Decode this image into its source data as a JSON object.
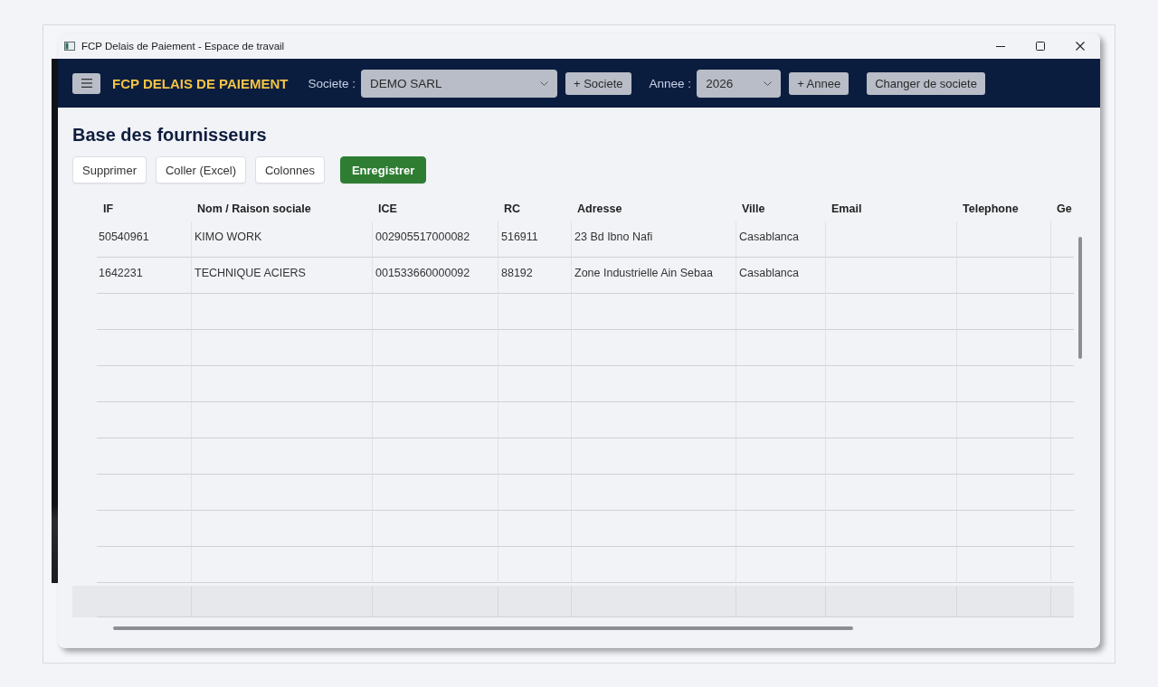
{
  "window": {
    "title": "FCP Delais de Paiement - Espace de travail"
  },
  "header": {
    "app_title": "FCP DELAIS DE PAIEMENT",
    "company": {
      "label": "Societe :",
      "value": "DEMO SARL"
    },
    "add_company_button": "+ Societe",
    "year": {
      "label": "Annee :",
      "value": "2026"
    },
    "add_year_button": "+ Annee",
    "change_company_button": "Changer de societe"
  },
  "page": {
    "title": "Base des fournisseurs"
  },
  "toolbar": [
    {
      "label": "Supprimer",
      "kind": "plain"
    },
    {
      "label": "Coller (Excel)",
      "kind": "plain"
    },
    {
      "label": "Colonnes",
      "kind": "plain"
    },
    {
      "label": "Enregistrer",
      "kind": "primary"
    }
  ],
  "table": {
    "columns": [
      "IF",
      "Nom / Raison sociale",
      "ICE",
      "RC",
      "Adresse",
      "Ville",
      "Email",
      "Telephone",
      "Ge"
    ],
    "rows": [
      {
        "cells": [
          "50540961",
          "KIMO WORK",
          "002905517000082",
          "516911",
          "23 Bd Ibno Nafi",
          "Casablanca"
        ]
      },
      {
        "cells": [
          "1642231",
          "TECHNIQUE ACIERS",
          "001533660000092",
          "88192",
          "Zone Industrielle Ain Sebaa",
          "Casablanca"
        ]
      }
    ]
  }
}
